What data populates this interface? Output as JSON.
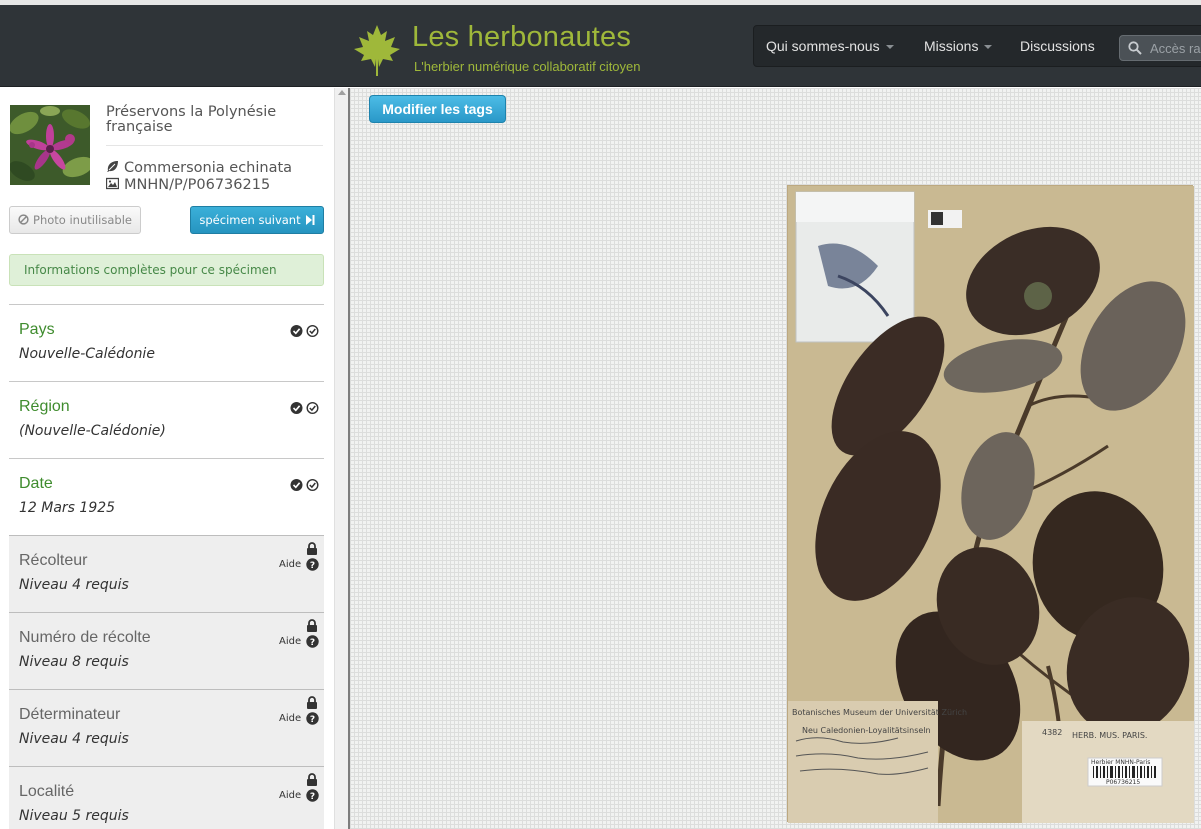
{
  "header": {
    "title": "Les herbonautes",
    "subtitle": "L'herbier numérique collaboratif citoyen",
    "nav": [
      {
        "label": "Qui sommes-nous",
        "dropdown": true
      },
      {
        "label": "Missions",
        "dropdown": true
      },
      {
        "label": "Discussions",
        "dropdown": false
      }
    ],
    "search_placeholder": "Accès ra",
    "colors": {
      "brand": "#9fb83a",
      "header_bg": "#2f3438"
    }
  },
  "sidebar": {
    "mission_title": "Préservons la Polynésie française",
    "species": "Commersonia echinata",
    "specimen_id": "MNHN/P/P06736215",
    "photo_button": "Photo inutilisable",
    "next_button": "spécimen suivant",
    "alert": "Informations complètes pour ce spécimen",
    "fields": [
      {
        "label": "Pays",
        "value": "Nouvelle-Calédonie",
        "locked": false
      },
      {
        "label": "Région",
        "value": "(Nouvelle-Calédonie)",
        "locked": false
      },
      {
        "label": "Date",
        "value": "12 Mars 1925",
        "locked": false
      },
      {
        "label": "Récolteur",
        "value": "Niveau 4 requis",
        "locked": true,
        "help": "Aide"
      },
      {
        "label": "Numéro de récolte",
        "value": "Niveau 8 requis",
        "locked": true,
        "help": "Aide"
      },
      {
        "label": "Déterminateur",
        "value": "Niveau 4 requis",
        "locked": true,
        "help": "Aide"
      },
      {
        "label": "Localité",
        "value": "Niveau 5 requis",
        "locked": true,
        "help": "Aide"
      }
    ]
  },
  "main": {
    "tags_button": "Modifier les tags",
    "specimen_labels": {
      "museum": "Botanisches Museum der Universität Zürich",
      "locality": "Neu Caledonien-Loyalitätsinseln",
      "herb": "HERB. MUS. PARIS.",
      "number": "4382",
      "barcode_top": "Herbier MNHN-Paris",
      "barcode_num": "P06736215"
    }
  }
}
